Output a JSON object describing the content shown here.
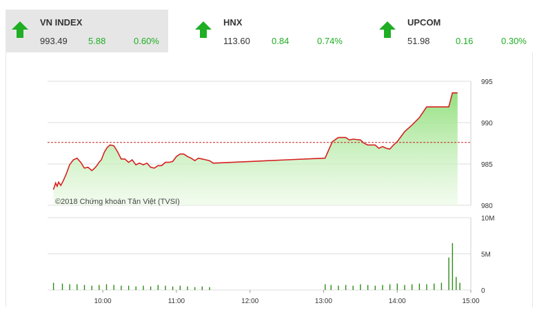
{
  "tickers": [
    {
      "name": "VN INDEX",
      "value": "993.49",
      "change": "5.88",
      "percent": "0.60%"
    },
    {
      "name": "HNX",
      "value": "113.60",
      "change": "0.84",
      "percent": "0.74%"
    },
    {
      "name": "UPCOM",
      "value": "51.98",
      "change": "0.16",
      "percent": "0.30%"
    }
  ],
  "colors": {
    "up": "#1fae24",
    "line": "#d61f1f",
    "area": "#9ee58b",
    "ref": "#c81e1e",
    "volume": "#2b8a17"
  },
  "copyright": "©2018 Chứng khoán Tân Việt (TVSI)",
  "chart_data": {
    "type": "line",
    "reference": 987.6,
    "price_axis": {
      "ylim": [
        980,
        995
      ],
      "ticks": [
        "980",
        "985",
        "990",
        "995"
      ],
      "tick_values": [
        980,
        985,
        990,
        995
      ]
    },
    "volume_axis": {
      "ylim": [
        0,
        10
      ],
      "ticks": [
        "0",
        "5M",
        "10M"
      ],
      "tick_values": [
        0,
        5,
        10
      ]
    },
    "x_axis": {
      "xlim": [
        9.25,
        15.0
      ],
      "ticks": [
        "10:00",
        "11:00",
        "12:00",
        "13:00",
        "14:00",
        "15:00"
      ],
      "tick_values": [
        10,
        11,
        12,
        13,
        14,
        15
      ]
    },
    "price_series": {
      "name": "",
      "x": [
        9.33,
        9.36,
        9.38,
        9.4,
        9.43,
        9.46,
        9.5,
        9.55,
        9.6,
        9.65,
        9.7,
        9.75,
        9.8,
        9.85,
        9.88,
        9.92,
        9.95,
        9.98,
        10.02,
        10.06,
        10.1,
        10.15,
        10.2,
        10.25,
        10.3,
        10.35,
        10.4,
        10.45,
        10.5,
        10.55,
        10.6,
        10.65,
        10.7,
        10.75,
        10.8,
        10.85,
        10.9,
        10.95,
        11.0,
        11.05,
        11.1,
        11.15,
        11.2,
        11.25,
        11.3,
        11.35,
        11.4,
        11.45,
        11.5,
        12.0,
        12.5,
        13.02,
        13.06,
        13.12,
        13.2,
        13.3,
        13.35,
        13.4,
        13.5,
        13.55,
        13.6,
        13.65,
        13.7,
        13.75,
        13.8,
        13.85,
        13.9,
        13.95,
        14.0,
        14.05,
        14.1,
        14.2,
        14.3,
        14.4,
        14.45,
        14.5,
        14.6,
        14.7,
        14.75,
        14.82
      ],
      "values": [
        981.9,
        982.7,
        982.3,
        982.8,
        982.4,
        982.9,
        983.7,
        984.9,
        985.5,
        985.7,
        985.2,
        984.5,
        984.6,
        984.2,
        984.4,
        984.8,
        985.2,
        985.5,
        986.4,
        987.0,
        987.3,
        987.2,
        986.5,
        985.6,
        985.6,
        985.2,
        985.5,
        984.9,
        985.1,
        984.9,
        985.1,
        984.6,
        984.5,
        984.8,
        984.8,
        985.2,
        985.2,
        985.3,
        985.9,
        986.2,
        986.2,
        985.9,
        985.7,
        985.4,
        985.7,
        985.6,
        985.5,
        985.4,
        985.1,
        985.3,
        985.5,
        985.7,
        986.5,
        987.7,
        988.2,
        988.2,
        987.9,
        988.0,
        987.9,
        987.5,
        987.3,
        987.3,
        987.3,
        986.9,
        987.1,
        986.9,
        986.8,
        987.3,
        987.7,
        988.3,
        988.9,
        989.7,
        990.6,
        991.9,
        991.9,
        991.9,
        991.9,
        991.9,
        993.6,
        993.6
      ]
    },
    "volume_series": {
      "name": "",
      "unit": "M",
      "x": [
        9.33,
        9.45,
        9.55,
        9.65,
        9.75,
        9.85,
        9.95,
        10.05,
        10.15,
        10.25,
        10.35,
        10.45,
        10.55,
        10.65,
        10.75,
        10.85,
        10.95,
        11.05,
        11.15,
        11.25,
        11.35,
        11.45,
        13.02,
        13.1,
        13.2,
        13.3,
        13.4,
        13.5,
        13.6,
        13.7,
        13.8,
        13.9,
        14.0,
        14.1,
        14.2,
        14.3,
        14.4,
        14.5,
        14.6,
        14.7,
        14.75,
        14.8,
        14.85
      ],
      "values": [
        1.0,
        0.9,
        0.8,
        0.8,
        0.7,
        0.6,
        0.7,
        0.8,
        0.7,
        0.6,
        0.6,
        0.5,
        0.6,
        0.5,
        0.7,
        0.6,
        0.5,
        0.6,
        0.5,
        0.4,
        0.5,
        0.4,
        0.8,
        0.7,
        0.6,
        0.7,
        0.6,
        0.8,
        0.7,
        0.6,
        0.7,
        0.8,
        0.9,
        0.7,
        0.8,
        0.9,
        0.8,
        0.9,
        1.0,
        4.5,
        6.5,
        1.8,
        1.0
      ]
    }
  }
}
